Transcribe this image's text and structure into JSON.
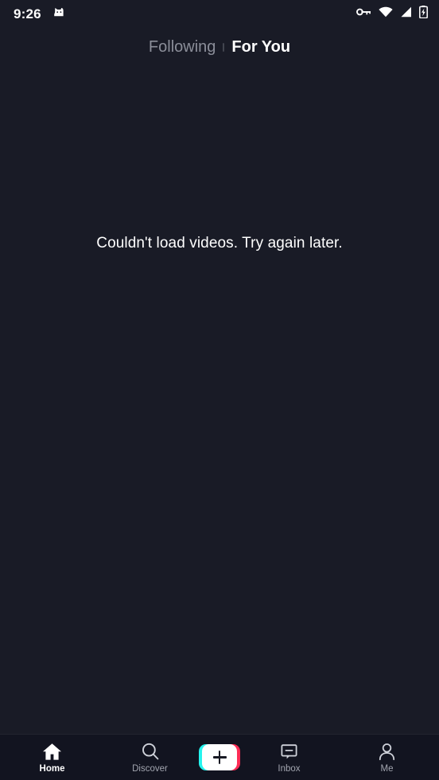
{
  "status_bar": {
    "time": "9:26",
    "notification_icon": "cat-app-notification-icon",
    "icons": [
      "vpn-key-icon",
      "wifi-icon",
      "cellular-signal-icon",
      "battery-charging-icon"
    ]
  },
  "top_tabs": {
    "following_label": "Following",
    "for_you_label": "For You",
    "active": "For You",
    "separator": "tab-separator-dot"
  },
  "feed": {
    "error_message": "Couldn't load videos. Try again later."
  },
  "bottom_nav": {
    "active": "Home",
    "items": [
      {
        "label": "Home",
        "icon": "home-icon"
      },
      {
        "label": "Discover",
        "icon": "search-icon"
      },
      {
        "label": "",
        "icon": "create-plus-icon"
      },
      {
        "label": "Inbox",
        "icon": "inbox-message-icon"
      },
      {
        "label": "Me",
        "icon": "profile-person-icon"
      }
    ]
  },
  "colors": {
    "background": "#191b26",
    "nav_background": "#121420",
    "accent_cyan": "#25f4ee",
    "accent_pink": "#fe2c55",
    "text_primary": "#ffffff",
    "text_muted": "#8b8e99"
  }
}
